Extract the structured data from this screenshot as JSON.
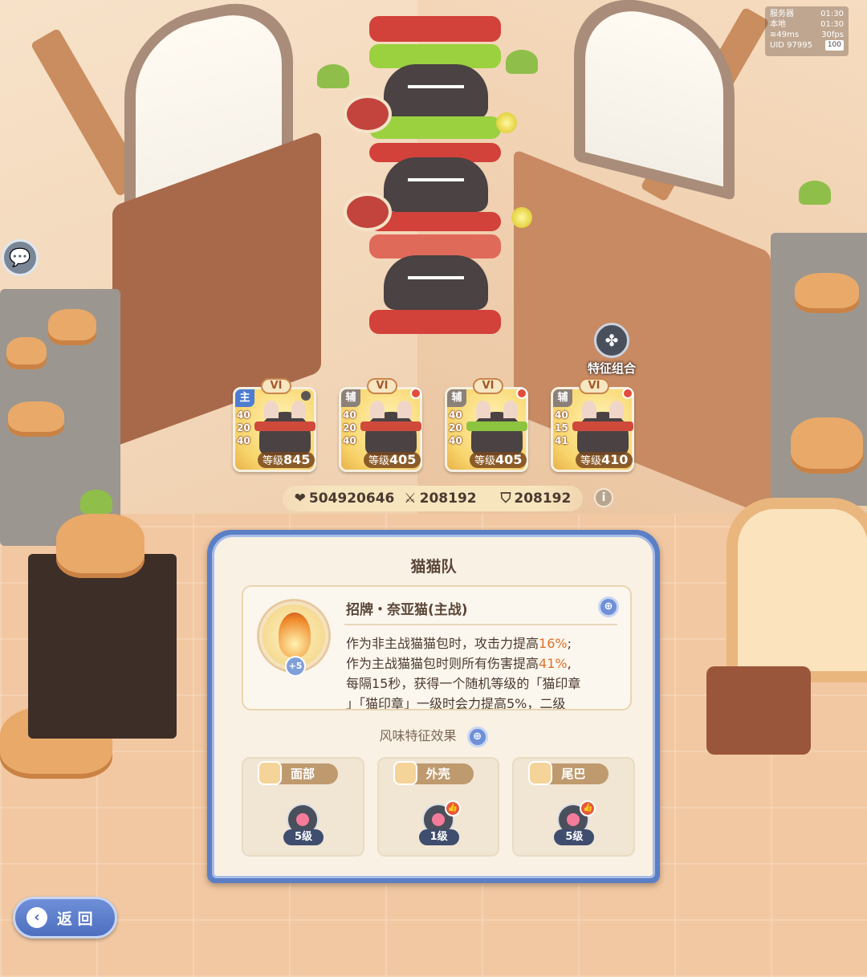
{
  "hud": {
    "server_label": "服务器",
    "server_time": "01:30",
    "local_label": "本地",
    "local_time": "01:30",
    "ping": "49ms",
    "fps": "30fps",
    "uid": "UID 97995",
    "battery": "100"
  },
  "feature_combo": {
    "label": "特征组合"
  },
  "team": [
    {
      "grade": "VI",
      "role": "主",
      "role_type": "main",
      "stats": [
        "40",
        "20",
        "40"
      ],
      "level_label": "等级",
      "level": "845",
      "band_color": "red"
    },
    {
      "grade": "VI",
      "role": "辅",
      "role_type": "sub",
      "stats": [
        "40",
        "20",
        "40"
      ],
      "level_label": "等级",
      "level": "405",
      "band_color": "red"
    },
    {
      "grade": "VI",
      "role": "辅",
      "role_type": "sub",
      "stats": [
        "40",
        "20",
        "40"
      ],
      "level_label": "等级",
      "level": "405",
      "band_color": "green"
    },
    {
      "grade": "VI",
      "role": "辅",
      "role_type": "sub",
      "stats": [
        "40",
        "15",
        "41"
      ],
      "level_label": "等级",
      "level": "410",
      "band_color": "red"
    }
  ],
  "totals": {
    "hp": "504920646",
    "attack": "208192",
    "defense": "208192"
  },
  "panel": {
    "title": "猫猫队",
    "skill": {
      "name": "招牌・奈亚猫(主战)",
      "badge": "+5",
      "desc_1a": "作为非主战猫猫包时，攻击力提高",
      "desc_1b": "16%",
      "desc_1c": ";",
      "desc_2a": "作为主战猫猫包时则所有伤害提高",
      "desc_2b": "41%",
      "desc_2c": ",",
      "desc_3": "每隔15秒，获得一个随机等级的「猫印章",
      "desc_4": "」「猫印章」一级时会力提高5%，二级"
    },
    "section_title": "风味特征效果",
    "traits": [
      {
        "name": "面部",
        "level": "5级",
        "recommended": false
      },
      {
        "name": "外壳",
        "level": "1级",
        "recommended": true
      },
      {
        "name": "尾巴",
        "level": "5级",
        "recommended": true
      }
    ]
  },
  "back": {
    "label": "返 回"
  },
  "colors": {
    "panel_frame": "#5b7fc5",
    "highlight": "#e0702a",
    "card_main_role": "#4d7cd1"
  }
}
